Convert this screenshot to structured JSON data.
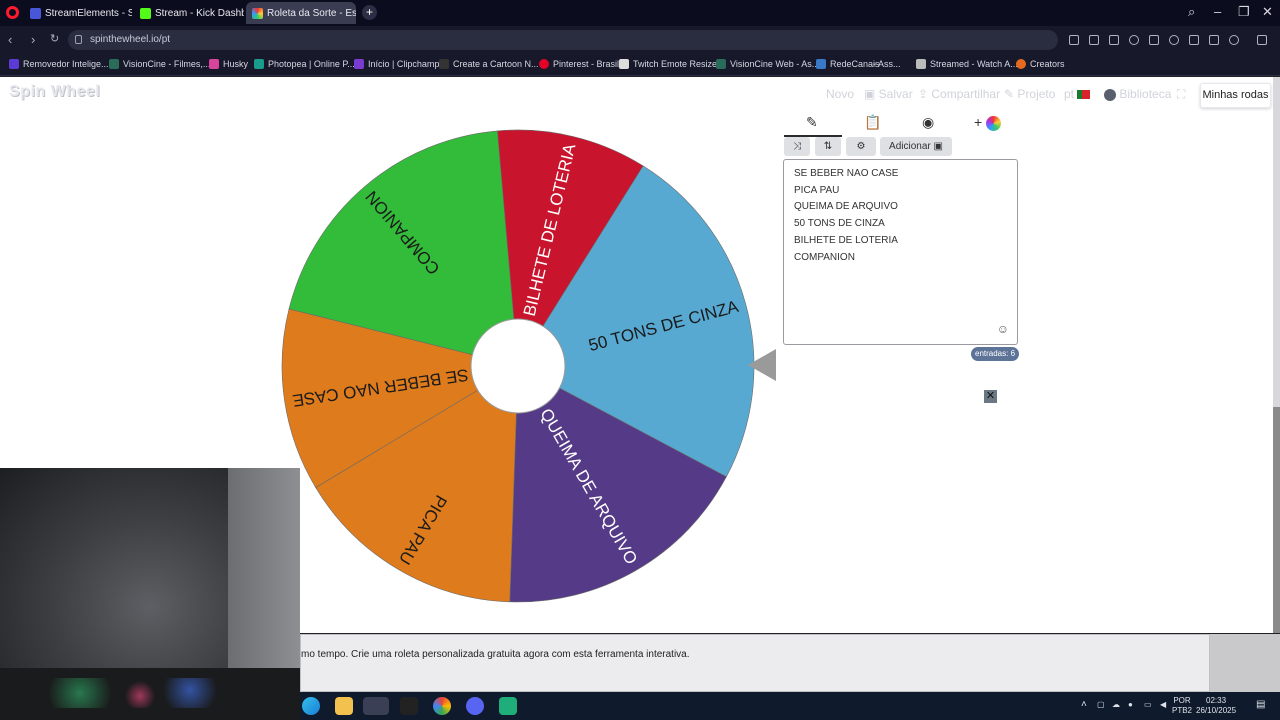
{
  "browser": {
    "tabs": [
      {
        "label": "StreamElements - Son",
        "active": false
      },
      {
        "label": "Stream - Kick Dashboard",
        "active": false
      },
      {
        "label": "Roleta da Sorte - Escolha",
        "active": true
      }
    ],
    "url": "spinthewheel.io/pt",
    "bookmarks": [
      "Removedor Intelige...",
      "VisionCine - Filmes,...",
      "Husky",
      "Photopea | Online P...",
      "Início | Clipchamp",
      "Create a Cartoon N...",
      "Pinterest - Brasil",
      "Twitch Emote Resizer",
      "VisionCine Web - As...",
      "RedeCanais",
      "- Ass...",
      "Streamed - Watch A...",
      "Creators"
    ]
  },
  "site": {
    "logo": "Spin Wheel",
    "nav": {
      "novo": "Novo",
      "salvar": "Salvar",
      "compartilhar": "Compartilhar",
      "projeto": "Projeto",
      "lang": "pt",
      "biblioteca": "Biblioteca",
      "minhas_rodas": "Minhas rodas"
    },
    "add_button": "Adicionar",
    "entries": [
      "SE BEBER NAO CASE",
      "PICA PAU",
      "QUEIMA DE ARQUIVO",
      "50 TONS DE CINZA",
      "BILHETE DE LOTERIA",
      "COMPANION"
    ],
    "count_label": "entradas: 6",
    "bottom_text": "mo tempo. Crie uma roleta personalizada gratuita agora com esta ferramenta interativa.",
    "wheel": {
      "segments": [
        {
          "label": "50 TONS DE CINZA",
          "color": "#58a9d1",
          "start": -58,
          "end": 28
        },
        {
          "label": "QUEIMA DE ARQUIVO",
          "color": "#553a87",
          "start": 28,
          "end": 92
        },
        {
          "label": "PICA PAU",
          "color": "#de7b1c",
          "start": 92,
          "end": 149
        },
        {
          "label": "SE BEBER NAO CASE",
          "color": "#de7b1c",
          "start": 149,
          "end": 194
        },
        {
          "label": "COMPANION",
          "color": "#33bb3a",
          "start": 194,
          "end": 265
        },
        {
          "label": "BILHETE DE LOTERIA",
          "color": "#c8142c",
          "start": 265,
          "end": 302
        }
      ]
    }
  },
  "taskbar": {
    "lang1": "POR",
    "lang2": "PTB2",
    "time": "02:33",
    "date": "26/10/2025"
  }
}
